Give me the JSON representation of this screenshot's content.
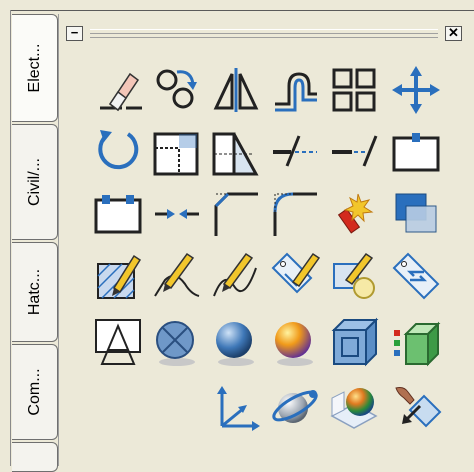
{
  "tabs": [
    {
      "label": "Elect..."
    },
    {
      "label": "Civil/..."
    },
    {
      "label": "Hatc..."
    },
    {
      "label": "Com..."
    },
    {
      "label": ""
    }
  ],
  "palette": {
    "minimize_symbol": "−",
    "close_symbol": "✕"
  },
  "tools": {
    "row1": [
      "erase-icon",
      "copy-icon",
      "mirror-icon",
      "offset-icon",
      "array-icon",
      "move-icon"
    ],
    "row2": [
      "rotate-icon",
      "scale-icon",
      "stretch-icon",
      "trim-icon",
      "extend-icon",
      "break-at-point-icon"
    ],
    "row3": [
      "break-icon",
      "join-icon",
      "chamfer-icon",
      "fillet-icon",
      "explode-icon",
      "draworder-icon"
    ],
    "row4": [
      "edit-hatch-icon",
      "edit-polyline-icon",
      "edit-spline-icon",
      "edit-attribute-icon",
      "block-editor-icon",
      "attribute-manager-icon"
    ],
    "row5": [
      "hide-icon",
      "shade-icon",
      "smooth-shade-icon",
      "materials-icon",
      "3d-box-icon",
      "visual-style-icon"
    ],
    "row6": [
      "ucs-icon",
      "3d-orbit-icon",
      "render-icon",
      "free-orbit-icon"
    ]
  },
  "colors": {
    "background": "#ece9d8",
    "accent_blue": "#2a6fbd",
    "pencil_yellow": "#f2c62b"
  }
}
